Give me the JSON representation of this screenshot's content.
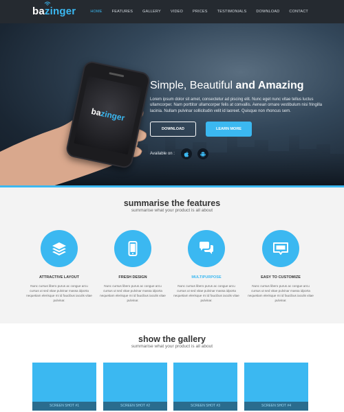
{
  "nav": {
    "logo_part1": "ba",
    "logo_part2": "zinger",
    "items": [
      {
        "label": "HOME",
        "active": true
      },
      {
        "label": "FEATURES"
      },
      {
        "label": "GALLERY"
      },
      {
        "label": "VIDEO"
      },
      {
        "label": "PRICES"
      },
      {
        "label": "TESTIMONIALS"
      },
      {
        "label": "DOWNLOAD"
      },
      {
        "label": "CONTACT"
      }
    ]
  },
  "hero": {
    "phone_logo_part1": "ba",
    "phone_logo_part2": "zinger",
    "title_light": "Simple, Beautiful ",
    "title_bold": "and Amazing",
    "text": "Lorem ipsum dolor sit amet, consectetur ad piscing elit. Nunc eget nunc vitae tellus luctus ullamcorper. Nam porttitor ullamcorper felis at convallis. Aenean ornare vestibulum nisi fringilla lacinia. Nullam pulvinar sollicitudin velit id laoreet. Quisque non rhoncus sem.",
    "download_label": "DOWNLOAD",
    "learn_label": "LEARN MORE",
    "available_label": "Available on :",
    "icons": [
      "apple-icon",
      "android-icon"
    ]
  },
  "features": {
    "title": "summarise the features",
    "subtitle": "summarise what your product is all about",
    "items": [
      {
        "title": "ATTRACTIVE LAYOUT",
        "icon": "layers-icon",
        "text": "Nunc cursus libero purus ac congue arcu cursus ut sed vitae pulvinar massa idporta nequetiam elerisque mi id faucibus iaculis vitae pulvinar."
      },
      {
        "title": "FRESH DESIGN",
        "icon": "mobile-icon",
        "text": "Nunc cursus libero purus ac congue arcu cursus ut sed vitae pulvinar massa idporta nequetiam elerisque mi id faucibus iaculis vitae pulvinar."
      },
      {
        "title": "MULTIPURPOSE",
        "icon": "chat-icon",
        "highlight": true,
        "text": "Nunc cursus libero purus ac congue arcu cursus ut sed vitae pulvinar massa idporta nequetiam elerisque mi id faucibus iaculis vitae pulvinar."
      },
      {
        "title": "EASY TO CUSTOMIZE",
        "icon": "message-icon",
        "text": "Nunc cursus libero purus ac congue arcu cursus ut sed vitae pulvinar massa idporta nequetiam elerisque mi id faucibus iaculis vitae pulvinar."
      }
    ]
  },
  "gallery": {
    "title": "show the gallery",
    "subtitle": "summarise what your product is all about",
    "shots": [
      "SCREEN SHOT #1",
      "SCREEN SHOT #2",
      "SCREEN SHOT #3",
      "SCREEN SHOT #4"
    ]
  },
  "colors": {
    "accent": "#3bb8f1",
    "nav_bg": "#252a30",
    "caption_bg": "#2a6c8e"
  }
}
